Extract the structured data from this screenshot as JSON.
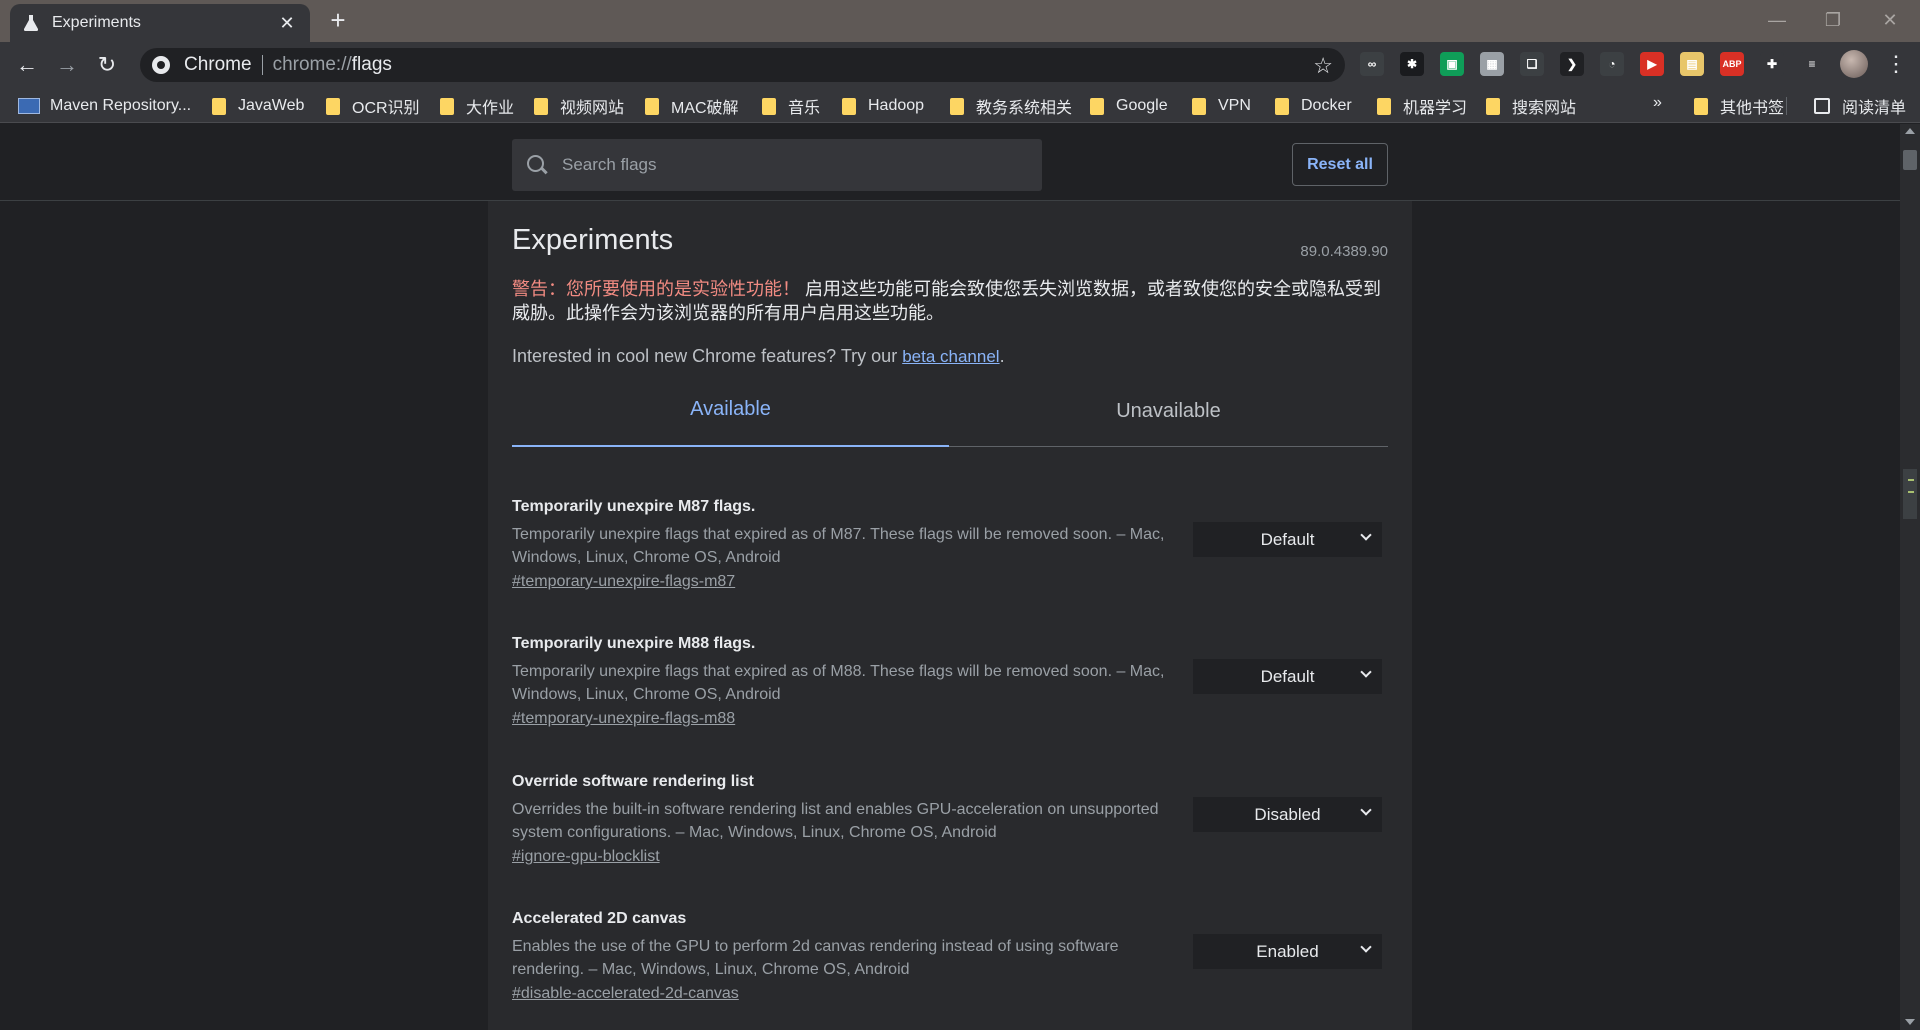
{
  "window": {
    "tab_title": "Experiments",
    "tab_close": "✕",
    "new_tab": "+",
    "controls": {
      "minimize": "—",
      "restore": "❐",
      "close": "✕"
    }
  },
  "toolbar": {
    "back": "←",
    "forward": "→",
    "reload": "↻",
    "omnibox": {
      "label": "Chrome",
      "url_scheme": "chrome://",
      "url_path": "flags"
    },
    "bookmark_star": "☆",
    "extensions": [
      {
        "name": "reader-ext-icon",
        "text": "∞",
        "color": "#3c4043"
      },
      {
        "name": "color-wheel-ext-icon",
        "text": "✱",
        "color": "#1a1b1e"
      },
      {
        "name": "green-ext-icon",
        "text": "▣",
        "color": "#0f9d58"
      },
      {
        "name": "image-ext-icon",
        "text": "▦",
        "color": "#9aa0a6"
      },
      {
        "name": "copy-ext-icon",
        "text": "❏",
        "color": "#3c4043"
      },
      {
        "name": "arrow-ext-icon",
        "text": "❯",
        "color": "#202124"
      },
      {
        "name": "clock-ext-icon",
        "text": "◔",
        "color": "#3c4043"
      },
      {
        "name": "red-play-ext-icon",
        "text": "▶",
        "color": "#d93025"
      },
      {
        "name": "screenshot-ext-icon",
        "text": "▤",
        "color": "#e8c66a"
      },
      {
        "name": "adblock-ext-icon",
        "text": "ABP",
        "color": "#d93025"
      },
      {
        "name": "puzzle-ext-icon",
        "text": "✚",
        "color": "#35363a"
      },
      {
        "name": "media-ext-icon",
        "text": "≡",
        "color": "#35363a"
      }
    ],
    "menu": "⋮"
  },
  "bookmarks": {
    "items": [
      {
        "label": "Maven Repository...",
        "type": "site"
      },
      {
        "label": "JavaWeb",
        "type": "folder"
      },
      {
        "label": "OCR识别",
        "type": "folder"
      },
      {
        "label": "大作业",
        "type": "folder"
      },
      {
        "label": "视频网站",
        "type": "folder"
      },
      {
        "label": "MAC破解",
        "type": "folder"
      },
      {
        "label": "音乐",
        "type": "folder"
      },
      {
        "label": "Hadoop",
        "type": "folder"
      },
      {
        "label": "教务系统相关",
        "type": "folder"
      },
      {
        "label": "Google",
        "type": "folder"
      },
      {
        "label": "VPN",
        "type": "folder"
      },
      {
        "label": "Docker",
        "type": "folder"
      },
      {
        "label": "机器学习",
        "type": "folder"
      },
      {
        "label": "搜索网站",
        "type": "folder"
      }
    ],
    "overflow": "»",
    "other_bookmarks": "其他书签",
    "reading_list": "阅读清单"
  },
  "search": {
    "placeholder": "Search flags",
    "value": ""
  },
  "reset_all": "Reset all",
  "header": {
    "title": "Experiments",
    "version": "89.0.4389.90",
    "warning_red": "警告：您所要使用的是实验性功能！",
    "warning_text": " 启用这些功能可能会致使您丢失浏览数据，或者致使您的安全或隐私受到威胁。此操作会为该浏览器的所有用户启用这些功能。",
    "beta_prefix": "Interested in cool new Chrome features? Try our ",
    "beta_link": "beta channel",
    "beta_suffix": "."
  },
  "tabs": {
    "available": "Available",
    "unavailable": "Unavailable"
  },
  "experiments": [
    {
      "name": "Temporarily unexpire M87 flags.",
      "description": "Temporarily unexpire flags that expired as of M87. These flags will be removed soon. – Mac, Windows, Linux, Chrome OS, Android",
      "link": "#temporary-unexpire-flags-m87",
      "value": "Default"
    },
    {
      "name": "Temporarily unexpire M88 flags.",
      "description": "Temporarily unexpire flags that expired as of M88. These flags will be removed soon. – Mac, Windows, Linux, Chrome OS, Android",
      "link": "#temporary-unexpire-flags-m88",
      "value": "Default"
    },
    {
      "name": "Override software rendering list",
      "description": "Overrides the built-in software rendering list and enables GPU-acceleration on unsupported system configurations. – Mac, Windows, Linux, Chrome OS, Android",
      "link": "#ignore-gpu-blocklist",
      "value": "Disabled"
    },
    {
      "name": "Accelerated 2D canvas",
      "description": "Enables the use of the GPU to perform 2d canvas rendering instead of using software rendering. – Mac, Windows, Linux, Chrome OS, Android",
      "link": "#disable-accelerated-2d-canvas",
      "value": "Enabled"
    }
  ]
}
